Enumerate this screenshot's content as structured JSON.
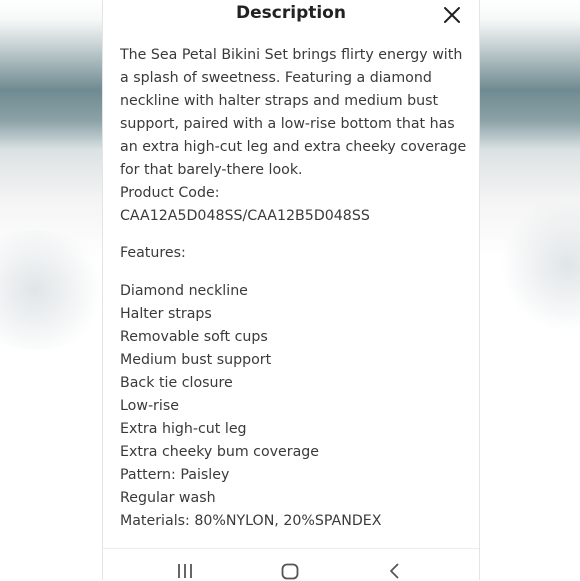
{
  "header": {
    "title": "Description"
  },
  "content": {
    "description": "The Sea Petal Bikini Set brings flirty energy with a splash of sweetness. Featuring a diamond neckline with halter straps and medium bust support, paired with a low-rise bottom that has an extra high-cut leg and extra cheeky coverage for that barely-there look.",
    "product_code_label": "Product Code:",
    "product_code_value": "CAA12A5D048SS/CAA12B5D048SS",
    "features_label": "Features:",
    "features": [
      "Diamond neckline",
      "Halter straps",
      "Removable soft cups",
      "Medium bust support",
      "Back tie closure",
      "Low-rise",
      "Extra high-cut leg",
      "Extra cheeky bum coverage",
      "Pattern: Paisley",
      "Regular wash",
      "Materials: 80%NYLON, 20%SPANDEX"
    ]
  },
  "navbar": {
    "icons": [
      "recent-apps-icon",
      "home-icon",
      "back-icon"
    ]
  }
}
